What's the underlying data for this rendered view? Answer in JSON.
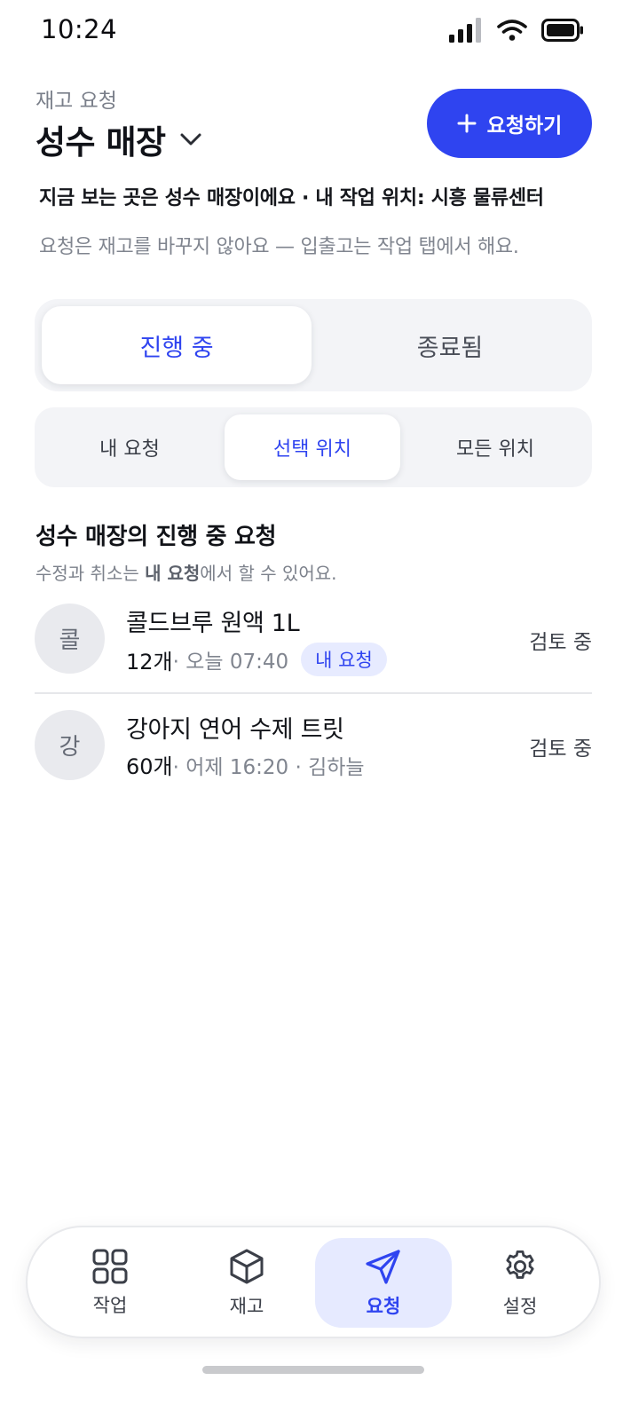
{
  "status_bar": {
    "time": "10:24",
    "icons": [
      "signal-icon",
      "wifi-icon",
      "battery-icon"
    ]
  },
  "header": {
    "subtitle": "재고 요청",
    "title": "성수 매장",
    "request_button": "요청하기"
  },
  "info": {
    "context_line": "지금 보는 곳은 성수 매장이에요 · 내 작업 위치: 시흥 물류센터",
    "hint_line": "요청은 재고를 바꾸지 않아요 — 입출고는 작업 탭에서 해요."
  },
  "status_tabs": [
    {
      "label": "진행 중",
      "active": true
    },
    {
      "label": "종료됨",
      "active": false
    }
  ],
  "scope_tabs": [
    {
      "label": "내 요청",
      "active": false
    },
    {
      "label": "선택 위치",
      "active": true
    },
    {
      "label": "모든 위치",
      "active": false
    }
  ],
  "section": {
    "title": "성수 매장의 진행 중 요청",
    "note_prefix": "수정과 취소는 ",
    "note_bold": "내 요청",
    "note_suffix": "에서 할 수 있어요."
  },
  "requests": [
    {
      "avatar": "콜",
      "name": "콜드브루 원액 1L",
      "qty": "12개",
      "meta": " · 오늘 07:40",
      "badge": "내 요청",
      "status": "검토 중"
    },
    {
      "avatar": "강",
      "name": "강아지 연어 수제 트릿",
      "qty": "60개",
      "meta": " · 어제 16:20 · 김하늘",
      "badge": "",
      "status": "검토 중"
    }
  ],
  "bottom_nav": [
    {
      "label": "작업",
      "icon": "grid-icon",
      "active": false
    },
    {
      "label": "재고",
      "icon": "box-icon",
      "active": false
    },
    {
      "label": "요청",
      "icon": "send-icon",
      "active": true
    },
    {
      "label": "설정",
      "icon": "gear-icon",
      "active": false
    }
  ],
  "colors": {
    "accent": "#2f44f0",
    "accent_soft": "#e6eaff",
    "muted_text": "#80858f",
    "segment_bg": "#f3f4f7"
  }
}
